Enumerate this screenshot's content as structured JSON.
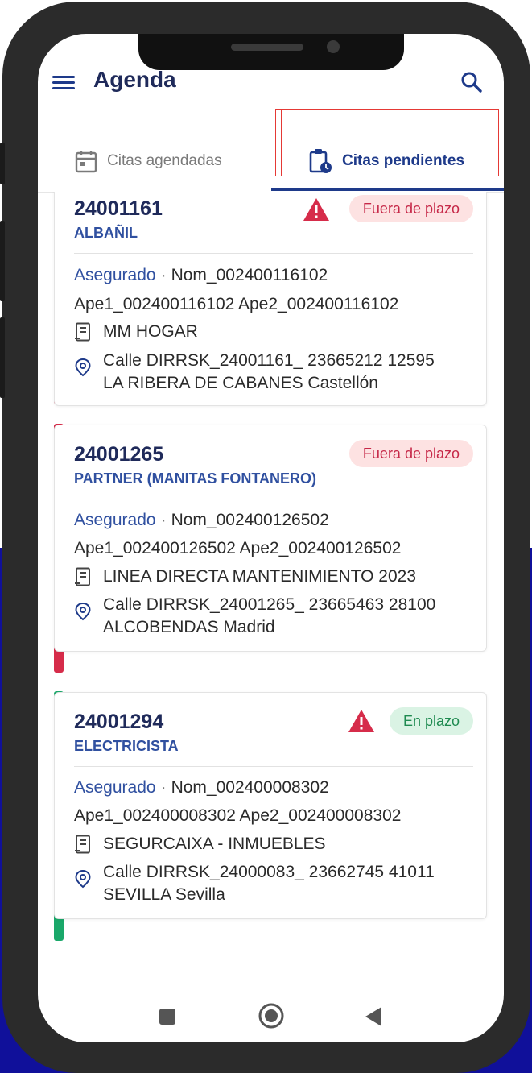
{
  "app": {
    "title": "Agenda"
  },
  "icons": {
    "menu": "hamburger-menu-icon",
    "search": "search-icon"
  },
  "tabs": [
    {
      "label": "Citas agendadas",
      "icon": "calendar-icon",
      "active": false
    },
    {
      "label": "Citas pendientes",
      "icon": "clipboard-clock-icon",
      "active": true
    }
  ],
  "colors": {
    "primary": "#1e3a8a",
    "out_of_time": "#c62848",
    "in_time": "#1e8a50"
  },
  "appointments": [
    {
      "code": "24001161",
      "trade": "ALBAÑIL",
      "status": "Fuera de plazo",
      "warning": true,
      "insured_label": "Asegurado",
      "separator": "·",
      "name": "Nom_002400116102",
      "surnames": "Ape1_002400116102 Ape2_002400116102",
      "company": "MM HOGAR",
      "address_line1": "Calle DIRRSK_24001161_ 23665212 12595",
      "address_line2": "LA RIBERA DE CABANES Castellón"
    },
    {
      "code": "24001265",
      "trade": "PARTNER (MANITAS FONTANERO)",
      "status": "Fuera de plazo",
      "warning": false,
      "insured_label": "Asegurado",
      "separator": "·",
      "name": "Nom_002400126502",
      "surnames": "Ape1_002400126502 Ape2_002400126502",
      "company": "LINEA DIRECTA MANTENIMIENTO 2023",
      "address_line1": "Calle DIRRSK_24001265_ 23665463 28100",
      "address_line2": "ALCOBENDAS Madrid"
    },
    {
      "code": "24001294",
      "trade": "ELECTRICISTA",
      "status": "En plazo",
      "warning": true,
      "insured_label": "Asegurado",
      "separator": "·",
      "name": "Nom_002400008302",
      "surnames": "Ape1_002400008302 Ape2_002400008302",
      "company": "SEGURCAIXA - INMUEBLES",
      "address_line1": "Calle DIRRSK_24000083_ 23662745 41011",
      "address_line2": "SEVILLA Sevilla"
    }
  ],
  "navbar": {
    "items": [
      "recents-icon",
      "home-icon",
      "back-icon"
    ]
  }
}
